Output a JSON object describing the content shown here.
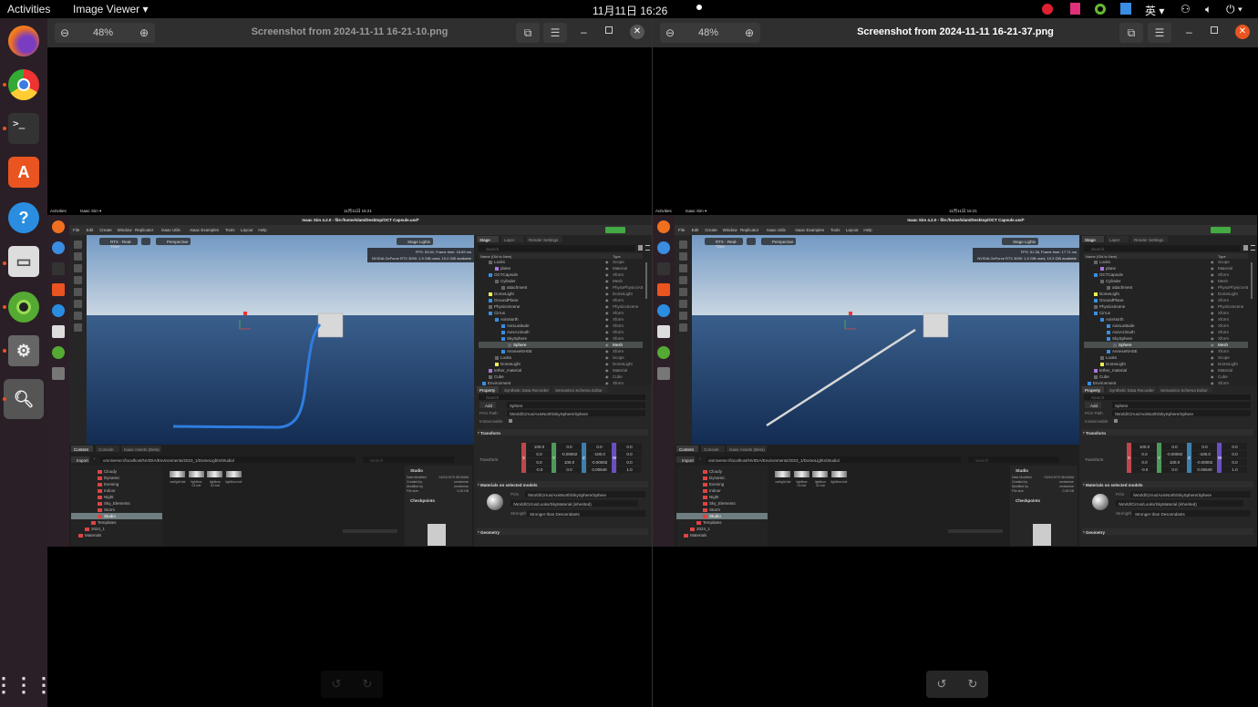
{
  "topbar": {
    "activities": "Activities",
    "app": "Image Viewer ▾",
    "datetime": "11月11日  16:26",
    "ime": "英 ▾",
    "status": "⏻ ▾"
  },
  "dock": {
    "apps": [
      "firefox",
      "chrome",
      "terminal",
      "software-center",
      "help",
      "files",
      "isaac",
      "isaac-sim",
      "image-viewer"
    ],
    "show_apps": "apps-grid"
  },
  "viewers": [
    {
      "zoom": "48%",
      "title": "Screenshot from 2024-11-11 16-21-10.png",
      "active": false,
      "fps_line1": "FPS: 53.50, Frame time: 18.69 ms",
      "fps_line2": "NVIDIA GeForce RTX 3090: 1.5 GiB used, 19.2 GiB available",
      "scene": "curved-cable"
    },
    {
      "zoom": "48%",
      "title": "Screenshot from 2024-11-11 16-21-37.png",
      "active": true,
      "fps_line1": "FPS: 51.38, Frame time: 17.71 ms",
      "fps_line2": "NVIDIA GeForce RTX 3090: 1.5 GiB used, 19.2 GiB available",
      "scene": "straight-cable"
    }
  ],
  "isaac": {
    "top_activities": "Activities",
    "top_app": "Isaac Sim ▾",
    "top_time": "11月11日  16:21",
    "title": "Isaac Sim 4.2.0 - file:/home/slam/Desktop/OCT Capsule.usd*",
    "menu": [
      "File",
      "Edit",
      "Create",
      "Window",
      "Replicator",
      "Isaac Utils",
      "Isaac Examples",
      "Tools",
      "Layout",
      "Help"
    ],
    "viewport": {
      "render": "RTX - Real-Time",
      "camera": "Perspective",
      "stage_lights": "Stage Lights"
    },
    "stage_tabs": [
      "Stage",
      "Layer",
      "Render Settings"
    ],
    "search": "Search",
    "tree_header": [
      "Name (Old to New)",
      "Type"
    ],
    "tree": [
      [
        "Looks",
        "Scope",
        1
      ],
      [
        "plane",
        "Material",
        2
      ],
      [
        "OCTCapsule",
        "Xform",
        1
      ],
      [
        "Cylinder",
        "Mesh",
        2
      ],
      [
        "attachment",
        "PhysxPhysicsAtt",
        3
      ],
      [
        "DomeLight",
        "DomeLight",
        1
      ],
      [
        "GroundPlane",
        "Xform",
        1
      ],
      [
        "PhysicsScene",
        "PhysicsScene",
        1
      ],
      [
        "Cirrus",
        "Xform",
        1
      ],
      [
        "AxisNorth",
        "Xform",
        2
      ],
      [
        "AxisLatitude",
        "Xform",
        3
      ],
      [
        "AxisAzimuth",
        "Xform",
        3
      ],
      [
        "SkySphere",
        "Xform",
        3
      ],
      [
        "Sphere",
        "Mesh",
        4
      ],
      [
        "AnnexeNHSE",
        "Xform",
        3
      ],
      [
        "Looks",
        "Scope",
        2
      ],
      [
        "DomeLight",
        "DomeLight",
        2
      ],
      [
        "tether_material",
        "Material",
        1
      ],
      [
        "Cube",
        "Cube",
        1
      ],
      [
        "Environment",
        "Xform",
        0
      ]
    ],
    "selected": "Sphere",
    "prop_tabs": [
      "Property",
      "Synthetic Data Recorder",
      "Semantics Schema Editor"
    ],
    "add": "Add",
    "prim_name": "Sphere",
    "prim_path_label": "Prim Path",
    "prim_path": "/World/Cirrus/AxisNorth/SkySphere/Sphere",
    "instanceable": "Instanceable",
    "transform_section": "Transform",
    "transform_label": "Transform",
    "matrix": [
      [
        "100.0",
        "0.0",
        "0.0",
        "0.0"
      ],
      [
        "0.0",
        "-0.00002",
        "-100.0",
        "0.0"
      ],
      [
        "0.0",
        "100.0",
        "-0.00002",
        "0.0"
      ],
      [
        "-0.0",
        "0.0",
        "0.00649",
        "1.0"
      ]
    ],
    "axes": [
      "X",
      "Y",
      "Z",
      "W"
    ],
    "materials_section": "Materials on selected models",
    "prim_label": "Prim",
    "material": "/World/Cirrus/Looks/SkyMaterial (inherited)",
    "strength_label": "Strength",
    "strength": "Stronger than Descendants",
    "geometry_section": "Geometry",
    "content_tabs": [
      "Content",
      "Console",
      "Isaac Assets (Beta)"
    ],
    "import": "Import",
    "content_path": "omniverse://localhost/NVIDIA/Environments/2023_1/DomeLights/Studio/",
    "folders": [
      [
        "Cloudy",
        3
      ],
      [
        "Dynamic",
        3
      ],
      [
        "Evening",
        3
      ],
      [
        "Indoor",
        3
      ],
      [
        "Night",
        3
      ],
      [
        "Sky_Elements",
        3
      ],
      [
        "Storm",
        3
      ],
      [
        "Studio",
        3
      ],
      [
        "Templates",
        2
      ],
      [
        "2024_1",
        1
      ],
      [
        "Materials",
        0
      ]
    ],
    "files": [
      "carlight.hdr",
      "lightbox 01.hdr",
      "lightbox 02.hdr",
      "lightbox.hdr"
    ],
    "info_title": "Studio",
    "info": [
      [
        "Date Modified",
        "01/01/1970 08:00AM"
      ],
      [
        "Created by",
        "omniverse"
      ],
      [
        "Modified by",
        "omniverse"
      ],
      [
        "File size",
        "0.00 KB"
      ]
    ],
    "checkpoints": "Checkpoints"
  },
  "colors": {
    "accent": "#e95420",
    "x_axis": "#c0464c",
    "y_axis": "#4e9a5a",
    "z_axis": "#3d7fb0",
    "w_axis": "#6a4fc0",
    "cable_left": "#2f7de0",
    "cable_right": "#d8d8d8"
  }
}
